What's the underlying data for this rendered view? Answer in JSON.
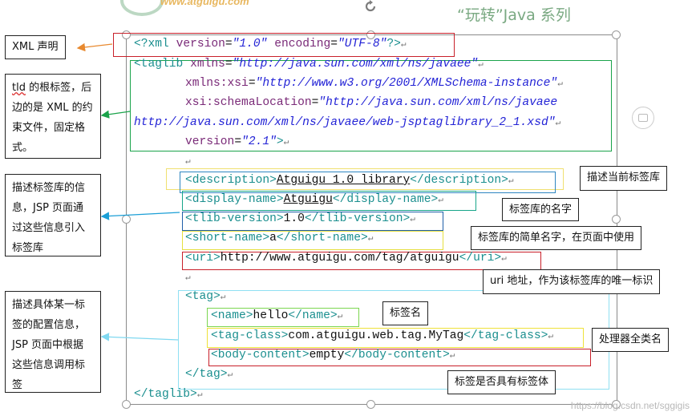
{
  "header": {
    "logo_text": "www.atguigu.com",
    "series_title": "“玩转”Java 系列"
  },
  "code": {
    "line1": {
      "open": "<?",
      "name": "xml",
      "attr1": "version",
      "eq": "=",
      "val1": "\"1.0\"",
      "attr2": "encoding",
      "val2": "\"UTF-8\"",
      "close": "?>"
    },
    "line2": {
      "open": "<taglib ",
      "attr": "xmlns",
      "val": "\"http://java.sun.com/xml/ns/javaee\""
    },
    "line3": {
      "attr": "xmlns:xsi",
      "val": "\"http://www.w3.org/2001/XMLSchema-instance\""
    },
    "line4": {
      "attr": "xsi:schemaLocation",
      "val": "\"http://java.sun.com/xml/ns/javaee"
    },
    "line5": {
      "val": "http://java.sun.com/xml/ns/javaee/web-jsptaglibrary_2_1.xsd\""
    },
    "line6": {
      "attr": "version",
      "val": "\"2.1\"",
      "close": ">"
    },
    "description": {
      "open": "<description>",
      "text": "Atguigu 1.0 library",
      "close": "</description>"
    },
    "display_name": {
      "open": "<display-name>",
      "text": "Atguigu",
      "close": "</display-name>"
    },
    "tlib_version": {
      "open": "<tlib-version>",
      "text": "1.0",
      "close": "</tlib-version>"
    },
    "short_name": {
      "open": "<short-name>",
      "text": "a",
      "close": "</short-name>"
    },
    "uri": {
      "open": "<uri>",
      "text": "http://www.atguigu.com/tag/atguigu",
      "close": "</uri>"
    },
    "tag_open": "<tag>",
    "name": {
      "open": "<name>",
      "text": "hello",
      "close": "</name>"
    },
    "tag_class": {
      "open": "<tag-class>",
      "text": "com.atguigu.web.tag.MyTag",
      "close": "</tag-class>"
    },
    "body_content": {
      "open": "<body-content>",
      "text": "empty",
      "close": "</body-content>"
    },
    "tag_close": "</tag>",
    "taglib_close": "</taglib>",
    "return_mark": "↵"
  },
  "notes": {
    "xml_decl": "XML 声明",
    "tld_root_prefix": "tld",
    "tld_root_rest": " 的根标签，后边的是 XML 的约束文件，固定格式。",
    "taglib_info": "描述标签库的信息，JSP 页面通过这些信息引入标签库",
    "tag_info": "描述具体某一标签的配置信息，JSP 页面中根据这些信息调用标签",
    "describe_current": "描述当前标签库",
    "lib_name": "标签库的名字",
    "short_name": "标签库的简单名字，在页面中使用",
    "uri_desc": "uri 地址，作为该标签库的唯一标识",
    "tag_name": "标签名",
    "handler_class": "处理器全类名",
    "has_body": "标签是否具有标签体"
  },
  "watermark": "https://blog.csdn.net/sggigis",
  "colors": {
    "orange": "#e8892f",
    "green": "#1aa34a",
    "teal": "#1b8f8f",
    "blue": "#1b7fcc",
    "cyan": "#7fd8f0",
    "yellow": "#e6df3f",
    "red": "#c8202a",
    "tag": "#1b8f8f",
    "attr": "#7a2a78",
    "value": "#2323d6"
  }
}
